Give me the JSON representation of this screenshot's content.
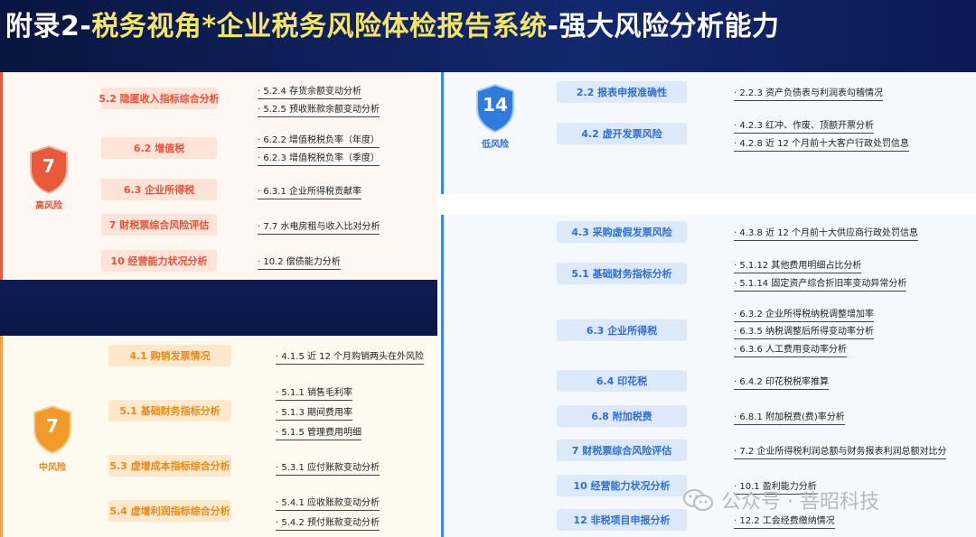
{
  "title": {
    "prefix": "附录2-",
    "highlight": "税务视角*企业税务风险体检报告系统",
    "suffix": "-强大风险分析能力"
  },
  "colors": {
    "high": "#e45b3d",
    "mid": "#f0a24a",
    "low": "#3f85e6"
  },
  "high": {
    "count": "7",
    "label": "高风险",
    "categories": [
      {
        "name": "5.2 隐匿收入指标综合分析",
        "items": [
          "5.2.4 存货余额变动分析",
          "5.2.5 预收账款余额变动分析"
        ]
      },
      {
        "name": "6.2 增值税",
        "items": [
          "6.2.2 增值税税负率（年度）",
          "6.2.3 增值税税负率（季度）"
        ]
      },
      {
        "name": "6.3 企业所得税",
        "items": [
          "6.3.1 企业所得税贡献率"
        ]
      },
      {
        "name": "7 财税票综合风险评估",
        "items": [
          "7.7 水电房租与收入比对分析"
        ]
      },
      {
        "name": "10 经营能力状况分析",
        "items": [
          "10.2 偿债能力分析"
        ]
      }
    ]
  },
  "mid": {
    "count": "7",
    "label": "中风险",
    "categories": [
      {
        "name": "4.1 购销发票情况",
        "items": [
          "4.1.5 近 12 个月购销两头在外风险"
        ]
      },
      {
        "name": "5.1 基础财务指标分析",
        "items": [
          "5.1.1 销售毛利率",
          "5.1.3 期间费用率",
          "5.1.5 管理费用明细"
        ]
      },
      {
        "name": "5.3 虚增成本指标综合分析",
        "items": [
          "5.3.1 应付账款变动分析"
        ]
      },
      {
        "name": "5.4 虚增利润指标综合分析",
        "items": [
          "5.4.1 应收账款变动分析",
          "5.4.2 预付账款变动分析"
        ]
      }
    ]
  },
  "low": {
    "count": "14",
    "label": "低风险",
    "categories": [
      {
        "name": "2.2 报表申报准确性",
        "items": [
          "2.2.3 资产负债表与利润表勾稽情况"
        ]
      },
      {
        "name": "4.2 虚开发票风险",
        "items": [
          "4.2.3 红冲、作废、顶额开票分析",
          "4.2.8 近 12 个月前十大客户行政处罚信息"
        ]
      },
      {
        "name": "4.3 采购虚假发票风险",
        "items": [
          "4.3.8 近 12 个月前十大供应商行政处罚信息"
        ]
      },
      {
        "name": "5.1 基础财务指标分析",
        "items": [
          "5.1.12 其他费用明细占比分析",
          "5.1.14 固定资产综合折旧率变动异常分析"
        ]
      },
      {
        "name": "6.3 企业所得税",
        "items": [
          "6.3.2 企业所得税纳税调整增加率",
          "6.3.5 纳税调整后所得变动率分析",
          "6.3.6 人工费用变动率分析"
        ]
      },
      {
        "name": "6.4 印花税",
        "items": [
          "6.4.2 印花税税率推算"
        ]
      },
      {
        "name": "6.8 附加税费",
        "items": [
          "6.8.1 附加税费(费)率分析"
        ]
      },
      {
        "name": "7 财税票综合风险评估",
        "items": [
          "7.2 企业所得税利润总额与财务报表利润总额对比分"
        ]
      },
      {
        "name": "10 经营能力状况分析",
        "items": [
          "10.1 盈利能力分析"
        ]
      },
      {
        "name": "12 非税项目申报分析",
        "items": [
          "12.2 工会经费缴纳情况"
        ]
      }
    ]
  },
  "watermark": "公众号 · 菩昭科技"
}
